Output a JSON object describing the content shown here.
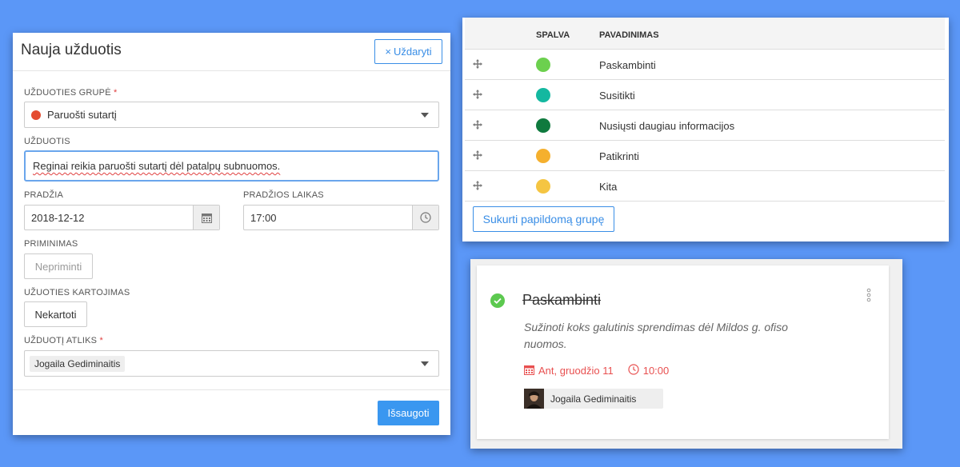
{
  "modal": {
    "title": "Nauja užduotis",
    "close_label": "Uždaryti",
    "group_label": "UŽDUOTIES GRUPĖ",
    "required_mark": "*",
    "group_value": "Paruošti sutartį",
    "task_label": "UŽDUOTIS",
    "task_value": "Reginai reikia paruošti sutartį dėl patalpų subnuomos.",
    "start_label": "PRADŽIA",
    "start_value": "2018-12-12",
    "start_time_label": "PRADŽIOS LAIKAS",
    "start_time_value": "17:00",
    "reminder_label": "PRIMINIMAS",
    "reminder_value": "Nepriminti",
    "repeat_label": "UŽUOTIES KARTOJIMAS",
    "repeat_value": "Nekartoti",
    "assignee_label": "UŽDUOTĮ ATLIKS",
    "assignee_value": "Jogaila Gediminaitis",
    "save_label": "Išsaugoti"
  },
  "groups": {
    "col_color": "SPALVA",
    "col_name": "PAVADINIMAS",
    "rows": [
      {
        "name": "Paskambinti",
        "color": "#6cd04e"
      },
      {
        "name": "Susitikti",
        "color": "#14b8a0"
      },
      {
        "name": "Nusiųsti daugiau informacijos",
        "color": "#0f7a3e"
      },
      {
        "name": "Patikrinti",
        "color": "#f5b02e"
      },
      {
        "name": "Kita",
        "color": "#f5c542"
      }
    ],
    "add_label": "Sukurti papildomą grupę"
  },
  "card": {
    "title": "Paskambinti",
    "description": "Sužinoti koks galutinis sprendimas dėl Mildos g. ofiso nuomos.",
    "date": "Ant, gruodžio 11",
    "time": "10:00",
    "assignee": "Jogaila Gediminaitis"
  }
}
